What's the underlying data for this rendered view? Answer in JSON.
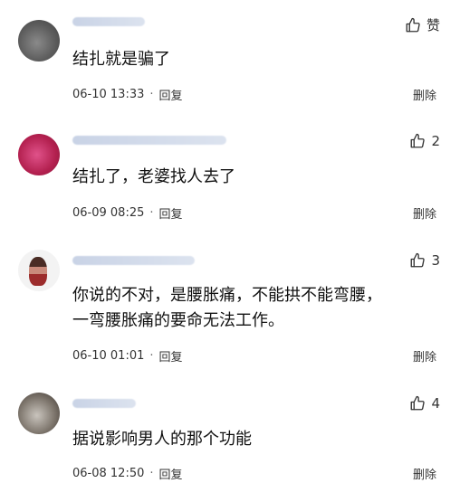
{
  "comments": [
    {
      "like_label": "赞",
      "text": "结扎就是骗了",
      "time": "06-10 13:33",
      "reply": "回复",
      "delete": "删除"
    },
    {
      "like_label": "2",
      "text": "结扎了，老婆找人去了",
      "time": "06-09 08:25",
      "reply": "回复",
      "delete": "删除"
    },
    {
      "like_label": "3",
      "text": "你说的不对，是腰胀痛，不能拱不能弯腰，\n一弯腰胀痛的要命无法工作。",
      "time": "06-10 01:01",
      "reply": "回复",
      "delete": "删除"
    },
    {
      "like_label": "4",
      "text": "据说影响男人的那个功能",
      "time": "06-08 12:50",
      "reply": "回复",
      "delete": "删除"
    }
  ],
  "separator": "·",
  "icons": {
    "like": "thumbs-up-icon"
  }
}
